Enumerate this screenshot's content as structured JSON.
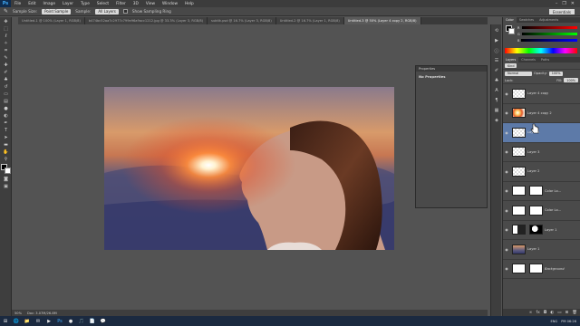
{
  "app": {
    "logo": "Ps"
  },
  "menu": [
    "File",
    "Edit",
    "Image",
    "Layer",
    "Type",
    "Select",
    "Filter",
    "3D",
    "View",
    "Window",
    "Help"
  ],
  "window_controls": [
    "–",
    "❐",
    "✕"
  ],
  "options": {
    "sample_size_label": "Sample Size:",
    "sample_size_value": "Point Sample",
    "sample_label": "Sample:",
    "sample_value": "All Layers",
    "show_ring_label": "Show Sampling Ring",
    "workspace": "Essentials"
  },
  "tabs": [
    {
      "label": "Untitled-1 @ 100% (Layer 1, RGB/8)",
      "active": false
    },
    {
      "label": "b474bc52aa7c2977c799e96a9acc1212.jpg @ 33.3% (Layer 3, RGB/8)",
      "active": false
    },
    {
      "label": "subtlk.psd @ 16.7% (Layer 3, RGB/8)",
      "active": false
    },
    {
      "label": "Untitled-2 @ 16.7% (Layer 1, RGB/8)",
      "active": false
    },
    {
      "label": "Untitled-3 @ 50% (Layer 4 copy 2, RGB/8)",
      "active": true
    }
  ],
  "status": {
    "zoom": "50%",
    "doc": "Doc: 3.07M/26.8M"
  },
  "properties": {
    "title": "Properties",
    "body": "No Properties"
  },
  "top_panel": {
    "tabs": [
      {
        "label": "Color",
        "active": true
      },
      {
        "label": "Swatches",
        "active": false
      },
      {
        "label": "Adjustments",
        "active": false
      }
    ],
    "sliders": [
      "R",
      "G",
      "B"
    ]
  },
  "layers_panel": {
    "tabs": [
      {
        "label": "Layers",
        "active": true
      },
      {
        "label": "Channels",
        "active": false
      },
      {
        "label": "Paths",
        "active": false
      }
    ],
    "kind": "Kind",
    "blend": "Normal",
    "opacity_label": "Opacity:",
    "opacity": "100%",
    "lock_label": "Lock:",
    "fill_label": "Fill:",
    "fill": "100%",
    "layers": [
      {
        "name": "Layer 4 copy",
        "thumb": "checker",
        "selected": false,
        "italic": false
      },
      {
        "name": "Layer 4 copy 2",
        "thumb": "flare",
        "selected": false,
        "italic": false
      },
      {
        "name": "Layer 4",
        "thumb": "checker",
        "selected": true,
        "italic": false
      },
      {
        "name": "Layer 3",
        "thumb": "checker",
        "selected": false,
        "italic": false
      },
      {
        "name": "Layer 2",
        "thumb": "checker",
        "selected": false,
        "italic": false
      },
      {
        "name": "Color Lo...",
        "thumb": "white",
        "selected": false,
        "italic": false
      },
      {
        "name": "Color Lo...",
        "thumb": "white",
        "selected": false,
        "italic": false
      },
      {
        "name": "Layer 1",
        "thumb": "portrait",
        "selected": false,
        "italic": false
      },
      {
        "name": "Layer 1",
        "thumb": "sunset",
        "selected": false,
        "italic": false
      },
      {
        "name": "Background",
        "thumb": "white",
        "selected": false,
        "italic": true
      }
    ]
  },
  "taskbar": {
    "icons": [
      "⊞",
      "🌐",
      "📁",
      "✉",
      "▶",
      "Ps",
      "●",
      "🎵",
      "📄",
      "💬"
    ],
    "language": "ENG",
    "time": "PM 06:26",
    "colors": {
      "bg": "#1b2a40",
      "accent": "#3fa9f5"
    }
  }
}
